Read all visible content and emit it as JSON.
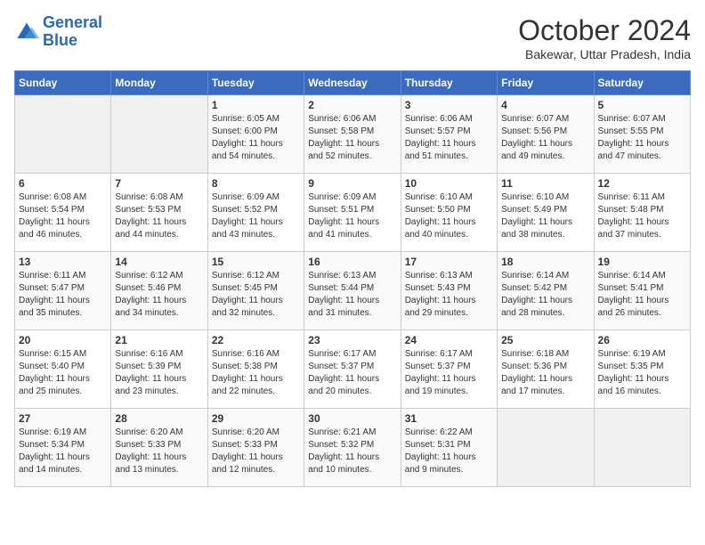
{
  "logo": {
    "text_general": "General",
    "text_blue": "Blue"
  },
  "title": "October 2024",
  "subtitle": "Bakewar, Uttar Pradesh, India",
  "header_days": [
    "Sunday",
    "Monday",
    "Tuesday",
    "Wednesday",
    "Thursday",
    "Friday",
    "Saturday"
  ],
  "weeks": [
    [
      {
        "day": "",
        "info": ""
      },
      {
        "day": "",
        "info": ""
      },
      {
        "day": "1",
        "info": "Sunrise: 6:05 AM\nSunset: 6:00 PM\nDaylight: 11 hours\nand 54 minutes."
      },
      {
        "day": "2",
        "info": "Sunrise: 6:06 AM\nSunset: 5:58 PM\nDaylight: 11 hours\nand 52 minutes."
      },
      {
        "day": "3",
        "info": "Sunrise: 6:06 AM\nSunset: 5:57 PM\nDaylight: 11 hours\nand 51 minutes."
      },
      {
        "day": "4",
        "info": "Sunrise: 6:07 AM\nSunset: 5:56 PM\nDaylight: 11 hours\nand 49 minutes."
      },
      {
        "day": "5",
        "info": "Sunrise: 6:07 AM\nSunset: 5:55 PM\nDaylight: 11 hours\nand 47 minutes."
      }
    ],
    [
      {
        "day": "6",
        "info": "Sunrise: 6:08 AM\nSunset: 5:54 PM\nDaylight: 11 hours\nand 46 minutes."
      },
      {
        "day": "7",
        "info": "Sunrise: 6:08 AM\nSunset: 5:53 PM\nDaylight: 11 hours\nand 44 minutes."
      },
      {
        "day": "8",
        "info": "Sunrise: 6:09 AM\nSunset: 5:52 PM\nDaylight: 11 hours\nand 43 minutes."
      },
      {
        "day": "9",
        "info": "Sunrise: 6:09 AM\nSunset: 5:51 PM\nDaylight: 11 hours\nand 41 minutes."
      },
      {
        "day": "10",
        "info": "Sunrise: 6:10 AM\nSunset: 5:50 PM\nDaylight: 11 hours\nand 40 minutes."
      },
      {
        "day": "11",
        "info": "Sunrise: 6:10 AM\nSunset: 5:49 PM\nDaylight: 11 hours\nand 38 minutes."
      },
      {
        "day": "12",
        "info": "Sunrise: 6:11 AM\nSunset: 5:48 PM\nDaylight: 11 hours\nand 37 minutes."
      }
    ],
    [
      {
        "day": "13",
        "info": "Sunrise: 6:11 AM\nSunset: 5:47 PM\nDaylight: 11 hours\nand 35 minutes."
      },
      {
        "day": "14",
        "info": "Sunrise: 6:12 AM\nSunset: 5:46 PM\nDaylight: 11 hours\nand 34 minutes."
      },
      {
        "day": "15",
        "info": "Sunrise: 6:12 AM\nSunset: 5:45 PM\nDaylight: 11 hours\nand 32 minutes."
      },
      {
        "day": "16",
        "info": "Sunrise: 6:13 AM\nSunset: 5:44 PM\nDaylight: 11 hours\nand 31 minutes."
      },
      {
        "day": "17",
        "info": "Sunrise: 6:13 AM\nSunset: 5:43 PM\nDaylight: 11 hours\nand 29 minutes."
      },
      {
        "day": "18",
        "info": "Sunrise: 6:14 AM\nSunset: 5:42 PM\nDaylight: 11 hours\nand 28 minutes."
      },
      {
        "day": "19",
        "info": "Sunrise: 6:14 AM\nSunset: 5:41 PM\nDaylight: 11 hours\nand 26 minutes."
      }
    ],
    [
      {
        "day": "20",
        "info": "Sunrise: 6:15 AM\nSunset: 5:40 PM\nDaylight: 11 hours\nand 25 minutes."
      },
      {
        "day": "21",
        "info": "Sunrise: 6:16 AM\nSunset: 5:39 PM\nDaylight: 11 hours\nand 23 minutes."
      },
      {
        "day": "22",
        "info": "Sunrise: 6:16 AM\nSunset: 5:38 PM\nDaylight: 11 hours\nand 22 minutes."
      },
      {
        "day": "23",
        "info": "Sunrise: 6:17 AM\nSunset: 5:37 PM\nDaylight: 11 hours\nand 20 minutes."
      },
      {
        "day": "24",
        "info": "Sunrise: 6:17 AM\nSunset: 5:37 PM\nDaylight: 11 hours\nand 19 minutes."
      },
      {
        "day": "25",
        "info": "Sunrise: 6:18 AM\nSunset: 5:36 PM\nDaylight: 11 hours\nand 17 minutes."
      },
      {
        "day": "26",
        "info": "Sunrise: 6:19 AM\nSunset: 5:35 PM\nDaylight: 11 hours\nand 16 minutes."
      }
    ],
    [
      {
        "day": "27",
        "info": "Sunrise: 6:19 AM\nSunset: 5:34 PM\nDaylight: 11 hours\nand 14 minutes."
      },
      {
        "day": "28",
        "info": "Sunrise: 6:20 AM\nSunset: 5:33 PM\nDaylight: 11 hours\nand 13 minutes."
      },
      {
        "day": "29",
        "info": "Sunrise: 6:20 AM\nSunset: 5:33 PM\nDaylight: 11 hours\nand 12 minutes."
      },
      {
        "day": "30",
        "info": "Sunrise: 6:21 AM\nSunset: 5:32 PM\nDaylight: 11 hours\nand 10 minutes."
      },
      {
        "day": "31",
        "info": "Sunrise: 6:22 AM\nSunset: 5:31 PM\nDaylight: 11 hours\nand 9 minutes."
      },
      {
        "day": "",
        "info": ""
      },
      {
        "day": "",
        "info": ""
      }
    ]
  ]
}
